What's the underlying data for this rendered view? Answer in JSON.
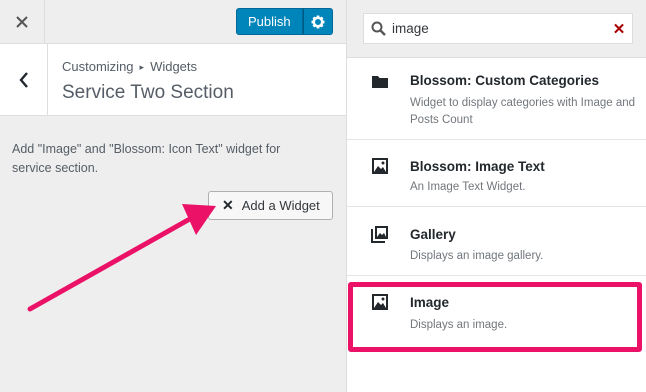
{
  "header": {
    "close_icon": "close-icon",
    "publish_label": "Publish",
    "gear_icon": "gear-icon"
  },
  "section": {
    "back_icon": "chevron-left-icon",
    "breadcrumb_root": "Customizing",
    "breadcrumb_separator": "▸",
    "breadcrumb_current": "Widgets",
    "title": "Service Two Section",
    "description": "Add \"Image\" and \"Blossom: Icon Text\" widget for service section.",
    "add_widget_label": "Add a Widget"
  },
  "search": {
    "value": "image",
    "icon": "search-icon",
    "clear_icon": "clear-icon"
  },
  "widgets": [
    {
      "name": "Blossom: Custom Categories",
      "description": "Widget to display categories with Image and Posts Count",
      "icon": "folder-icon"
    },
    {
      "name": "Blossom: Image Text",
      "description": "An Image Text Widget.",
      "icon": "image-icon"
    },
    {
      "name": "Gallery",
      "description": "Displays an image gallery.",
      "icon": "gallery-icon"
    },
    {
      "name": "Image",
      "description": "Displays an image.",
      "icon": "image-icon"
    }
  ],
  "colors": {
    "accent": "#0085ba",
    "highlight": "#ea1167",
    "clear": "#aa0000"
  }
}
